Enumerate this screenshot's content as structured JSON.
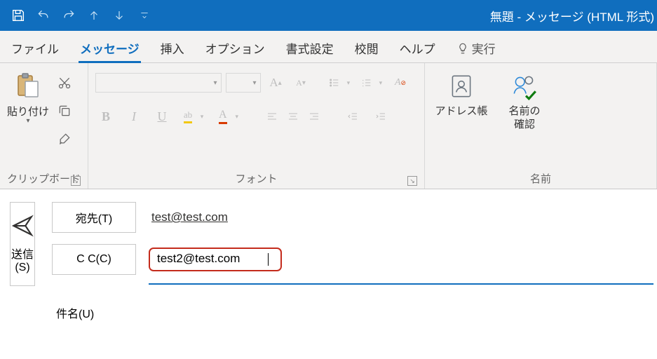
{
  "window": {
    "title": "無題  -  メッセージ (HTML 形式)"
  },
  "qat": {
    "save": "save-icon",
    "undo": "undo-icon",
    "redo": "redo-icon",
    "up": "up-arrow-icon",
    "down": "down-arrow-icon",
    "custom": "customize-icon"
  },
  "tabs": {
    "file": "ファイル",
    "message": "メッセージ",
    "insert": "挿入",
    "options": "オプション",
    "format": "書式設定",
    "review": "校閲",
    "help": "ヘルプ",
    "tellme": "実行"
  },
  "ribbon": {
    "clipboard": {
      "label": "クリップボード",
      "paste": "貼り付け"
    },
    "font": {
      "label": "フォント",
      "bold": "B",
      "italic": "I",
      "underline": "U",
      "highlight": "ab",
      "color": "A",
      "grow": "A",
      "shrink": "A",
      "clear": "A"
    },
    "names": {
      "label": "名前",
      "addressbook": "アドレス帳",
      "checknames_l1": "名前の",
      "checknames_l2": "確認"
    }
  },
  "compose": {
    "send_l1": "送信",
    "send_l2": "(S)",
    "to_label": "宛先(T)",
    "cc_label": "C C(C)",
    "subject_label": "件名(U)",
    "to_value": "test@test.com",
    "cc_value": "test2@test.com"
  }
}
